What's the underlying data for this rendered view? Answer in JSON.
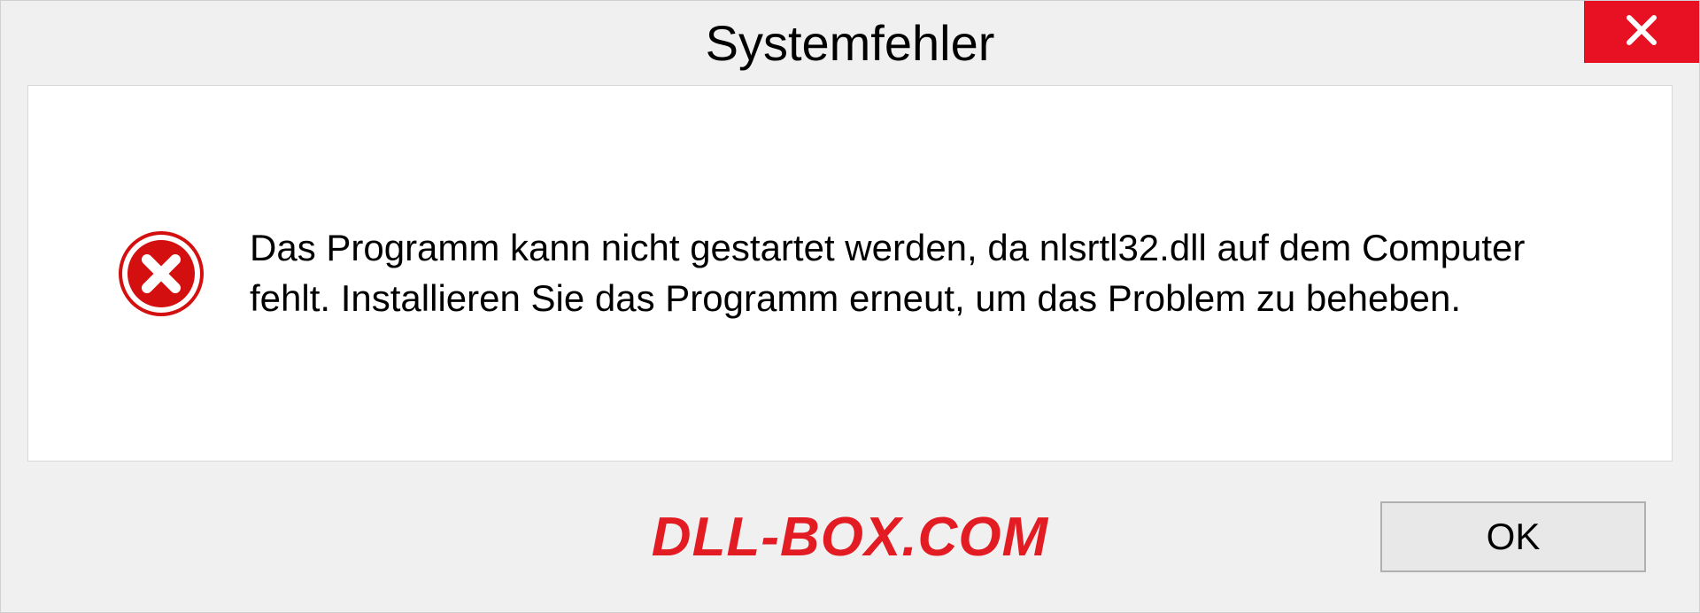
{
  "dialog": {
    "title": "Systemfehler",
    "message": "Das Programm kann nicht gestartet werden, da nlsrtl32.dll auf dem Computer fehlt. Installieren Sie das Programm erneut, um das Problem zu beheben.",
    "ok_label": "OK"
  },
  "watermark": "DLL-BOX.COM"
}
